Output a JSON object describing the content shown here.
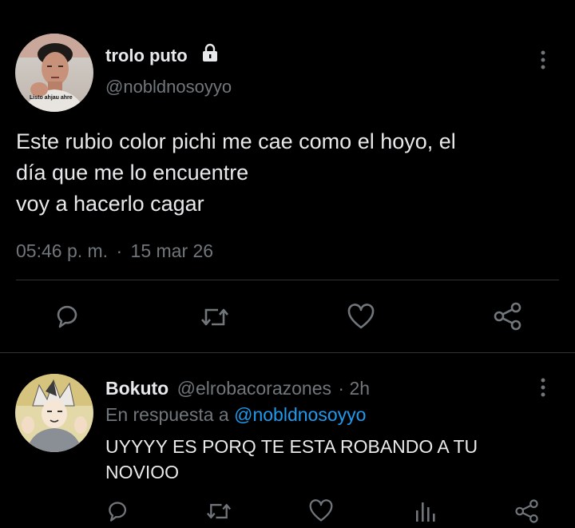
{
  "main_tweet": {
    "display_name": "trolo puto",
    "handle": "@nobldnosoyyo",
    "avatar_caption": "Listo ahjau ahre",
    "text_lines": [
      "Este rubio color pichi me cae como el hoyo, el",
      "día que me lo encuentre",
      "voy a hacerlo cagar"
    ],
    "time": "05:46 p. m.",
    "separator": "·",
    "date": "15 mar 26",
    "icons": [
      "more-vertical-icon",
      "lock-icon",
      "reply-icon",
      "retweet-icon",
      "like-icon",
      "share-icon"
    ]
  },
  "reply": {
    "display_name": "Bokuto",
    "handle": "@elrobacorazones",
    "separator": "·",
    "age": "2h",
    "in_reply_prefix": "En respuesta a",
    "in_reply_handle": "@nobldnosoyyo",
    "text_lines": [
      "UYYYY ES PORQ TE ESTA ROBANDO A TU",
      "NOVIOO"
    ],
    "icons": [
      "more-vertical-icon",
      "reply-icon",
      "retweet-icon",
      "like-icon",
      "analytics-icon",
      "share-icon"
    ]
  },
  "colors": {
    "background": "#000000",
    "text": "#e7e9ea",
    "muted": "#71767b",
    "link": "#1d9bf0",
    "divider": "#2f3336"
  }
}
